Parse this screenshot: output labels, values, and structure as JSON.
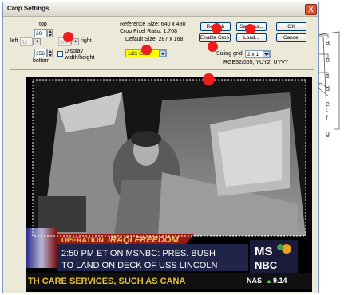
{
  "window": {
    "title": "Crop Settings",
    "close_glyph": "X"
  },
  "crop": {
    "top_label": "top",
    "top_value": "20",
    "left_label": "left",
    "left_value": "32",
    "right_label": "right",
    "right_value": "604",
    "bottom_label": "bottom",
    "bottom_value": "356",
    "display_wh_label_1": "Display",
    "display_wh_label_2": "width/height",
    "display_wh_checked": false
  },
  "info": {
    "reference_size": "Reference Size: 640 x 480",
    "crop_pixel_ratio": "Crop Pixel Ratio: 1.708",
    "default_size": "Default Size: 287 x 168"
  },
  "preset": {
    "selected": "1/2x Crop",
    "highlight_color": "#ffff00"
  },
  "buttons": {
    "refresh": "Refresh",
    "save_as": "Save As...",
    "ok": "OK",
    "enable_crop": "Enable Crop",
    "load": "Load...",
    "cancel": "Cancel"
  },
  "sizing_grid": {
    "label": "Sizing grid:",
    "selected": "2 x 1"
  },
  "formats": "RGB32/555, YUY2, UYVY",
  "callouts": [
    "a",
    "b",
    "c",
    "d",
    "e",
    "f",
    "g"
  ],
  "video": {
    "banner_program": "OPERATION",
    "banner_title": "IRAQI FREEDOM",
    "headline_line1": "2:50 PM ET ON MSNBC: PRES. BUSH",
    "headline_line2": "TO LAND ON DECK OF USS LINCOLN",
    "ticker": "TH CARE SERVICES, SUCH AS CANA",
    "market": "NAS",
    "market_value": "9.14",
    "network_top": "MS",
    "network_bottom": "NBC"
  },
  "colors": {
    "annotation": "#ee1c1c",
    "callout_line": "#555555",
    "banner_red": "#9a1a12"
  }
}
